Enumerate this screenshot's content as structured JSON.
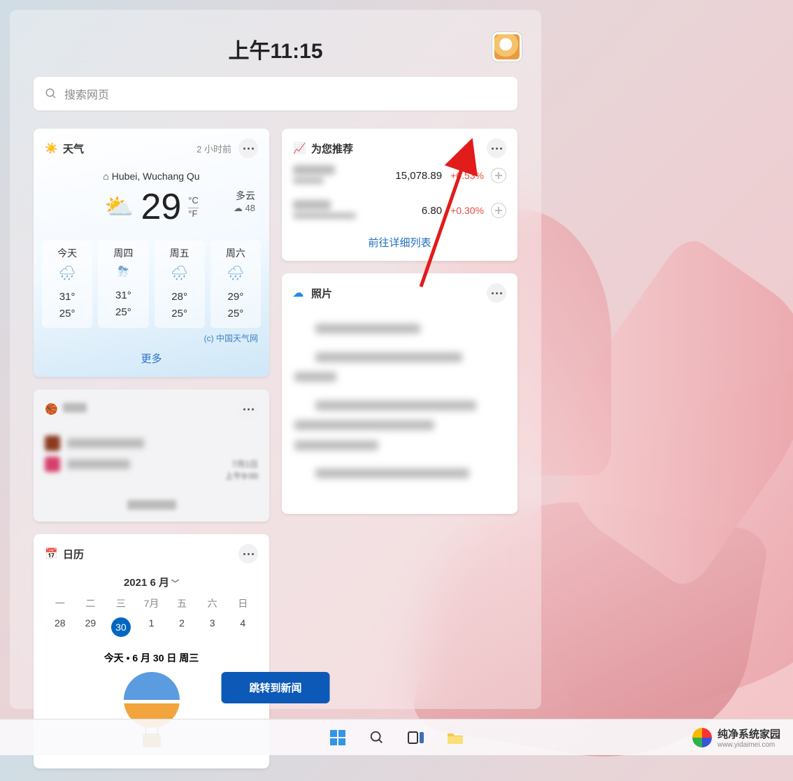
{
  "time": "上午11:15",
  "search": {
    "placeholder": "搜索网页"
  },
  "weather": {
    "title": "天气",
    "updated": "2 小时前",
    "location": "Hubei, Wuchang Qu",
    "temp": "29",
    "unit_c": "°C",
    "unit_f": "°F",
    "condition": "多云",
    "humidity": "48",
    "humidity_icon": "☁",
    "forecast": [
      {
        "day": "今天",
        "hi": "31°",
        "lo": "25°"
      },
      {
        "day": "周四",
        "hi": "31°",
        "lo": "25°"
      },
      {
        "day": "周五",
        "hi": "28°",
        "lo": "25°"
      },
      {
        "day": "周六",
        "hi": "29°",
        "lo": "25°"
      }
    ],
    "source": "(c) 中国天气网",
    "more": "更多"
  },
  "nba": {
    "title": "NBA",
    "meta_top": "7月1日",
    "meta_bot": "上午9:00",
    "footer": "查看 NBA"
  },
  "calendar": {
    "title": "日历",
    "month": "2021 6 月",
    "dows": [
      "一",
      "二",
      "三",
      "7月",
      "五",
      "六",
      "日"
    ],
    "days": [
      "28",
      "29",
      "30",
      "1",
      "2",
      "3",
      "4"
    ],
    "today_index": 2,
    "subtitle": "今天 • 6 月 30 日 周三"
  },
  "recommend": {
    "title": "为您推荐",
    "rows": [
      {
        "value": "15,078.89",
        "change": "+0.53%"
      },
      {
        "value": "6.80",
        "change": "+0.30%"
      }
    ],
    "link": "前往详细列表"
  },
  "photos": {
    "title": "照片"
  },
  "news_button": "跳转到新闻",
  "watermark": {
    "name": "纯净系统家园",
    "url": "www.yidaimei.com"
  }
}
